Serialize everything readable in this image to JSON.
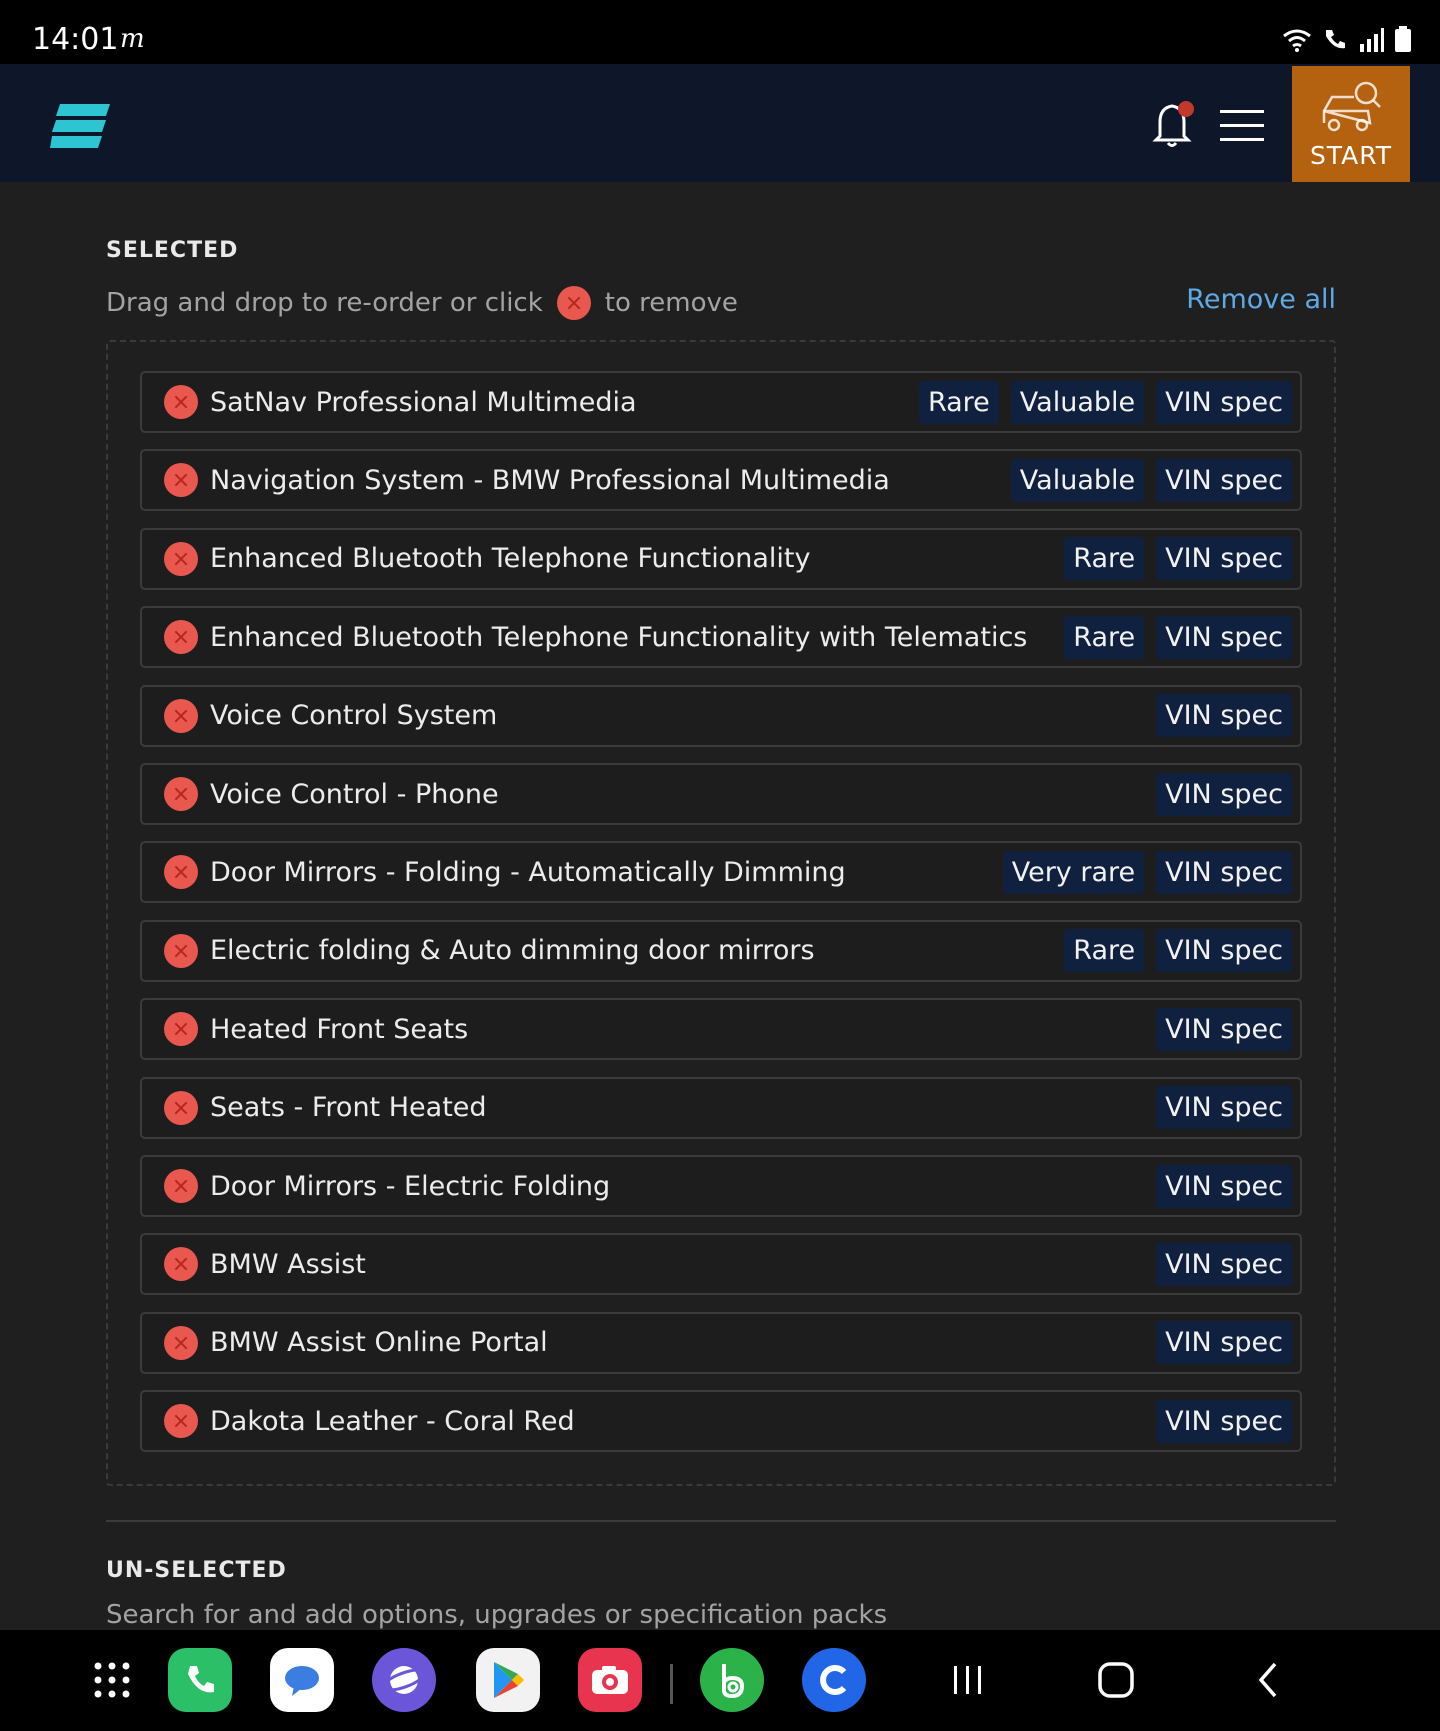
{
  "status_bar": {
    "time": "14:01",
    "indicator": "m"
  },
  "header": {
    "start_label": "START",
    "icons": [
      "logo-icon",
      "bell-icon",
      "menu-icon",
      "car-search-icon"
    ]
  },
  "selected": {
    "title": "SELECTED",
    "hint_before": "Drag and drop to re-order or click",
    "hint_after": "to remove",
    "remove_all": "Remove all",
    "items": [
      {
        "label": "SatNav Professional Multimedia",
        "badges": [
          "Rare",
          "Valuable",
          "VIN spec"
        ]
      },
      {
        "label": "Navigation System - BMW Professional Multimedia",
        "badges": [
          "Valuable",
          "VIN spec"
        ]
      },
      {
        "label": "Enhanced Bluetooth Telephone Functionality",
        "badges": [
          "Rare",
          "VIN spec"
        ]
      },
      {
        "label": "Enhanced Bluetooth Telephone Functionality with Telematics",
        "badges": [
          "Rare",
          "VIN spec"
        ]
      },
      {
        "label": "Voice Control System",
        "badges": [
          "VIN spec"
        ]
      },
      {
        "label": "Voice Control - Phone",
        "badges": [
          "VIN spec"
        ]
      },
      {
        "label": "Door Mirrors - Folding - Automatically Dimming",
        "badges": [
          "Very rare",
          "VIN spec"
        ]
      },
      {
        "label": "Electric folding & Auto dimming door mirrors",
        "badges": [
          "Rare",
          "VIN spec"
        ]
      },
      {
        "label": "Heated Front Seats",
        "badges": [
          "VIN spec"
        ]
      },
      {
        "label": "Seats - Front Heated",
        "badges": [
          "VIN spec"
        ]
      },
      {
        "label": "Door Mirrors - Electric Folding",
        "badges": [
          "VIN spec"
        ]
      },
      {
        "label": "BMW Assist",
        "badges": [
          "VIN spec"
        ]
      },
      {
        "label": "BMW Assist Online Portal",
        "badges": [
          "VIN spec"
        ]
      },
      {
        "label": "Dakota Leather - Coral Red",
        "badges": [
          "VIN spec"
        ]
      }
    ]
  },
  "unselected": {
    "title": "UN-SELECTED",
    "hint": "Search for and add options, upgrades or specification packs"
  },
  "colors": {
    "accent": "#5ea9e6",
    "start": "#b4620f",
    "remove": "#e9584f",
    "badge": "#10203f",
    "logo": "#2ec5d3"
  },
  "nav_apps": [
    "apps-grid-icon",
    "phone-app-icon",
    "messages-app-icon",
    "internet-app-icon",
    "play-store-icon",
    "camera-app-icon",
    "bolt-app-icon",
    "c-app-icon",
    "recents-icon",
    "home-icon",
    "back-icon"
  ]
}
